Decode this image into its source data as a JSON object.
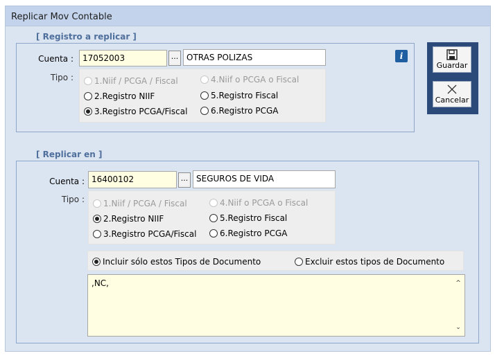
{
  "window": {
    "title": "Replicar Mov Contable"
  },
  "group_source": {
    "legend": "[ Registro a replicar ]",
    "cuenta_label": "Cuenta :",
    "cuenta_value": "17052003",
    "cuenta_desc": "OTRAS POLIZAS",
    "tipo_label": "Tipo :",
    "options": [
      {
        "label": "1.Niif / PCGA / Fiscal",
        "state": "disabled"
      },
      {
        "label": "4.Niif o PCGA o Fiscal",
        "state": "disabled"
      },
      {
        "label": "2.Registro NIIF",
        "state": "off"
      },
      {
        "label": "5.Registro Fiscal",
        "state": "off"
      },
      {
        "label": "3.Registro PCGA/Fiscal",
        "state": "selected"
      },
      {
        "label": "6.Registro PCGA",
        "state": "off"
      }
    ]
  },
  "group_target": {
    "legend": "[ Replicar en ]",
    "cuenta_label": "Cuenta :",
    "cuenta_value": "16400102",
    "cuenta_desc": "SEGUROS DE VIDA",
    "tipo_label": "Tipo :",
    "options": [
      {
        "label": "1.Niif / PCGA / Fiscal",
        "state": "disabled"
      },
      {
        "label": "4.Niif o PCGA o Fiscal",
        "state": "disabled"
      },
      {
        "label": "2.Registro NIIF",
        "state": "selected"
      },
      {
        "label": "5.Registro Fiscal",
        "state": "off"
      },
      {
        "label": "3.Registro PCGA/Fiscal",
        "state": "off"
      },
      {
        "label": "6.Registro PCGA",
        "state": "off"
      }
    ],
    "doc_filter": {
      "include_label": "Incluir sólo estos Tipos de Documento",
      "exclude_label": "Excluir estos tipos de Documento",
      "selected": "include"
    },
    "doc_types_text": ",NC,"
  },
  "browse_label": "...",
  "info_icon_glyph": "i",
  "toolbar": {
    "save_label": "Guardar",
    "cancel_label": "Cancelar"
  },
  "icons": {
    "save": "floppy-disk-icon",
    "cancel": "x-cross-icon",
    "info": "info-icon"
  },
  "colors": {
    "legend": "#4f6f9c",
    "toolbar_bg": "#2b4a7a",
    "field_yellow": "#fffee2"
  }
}
